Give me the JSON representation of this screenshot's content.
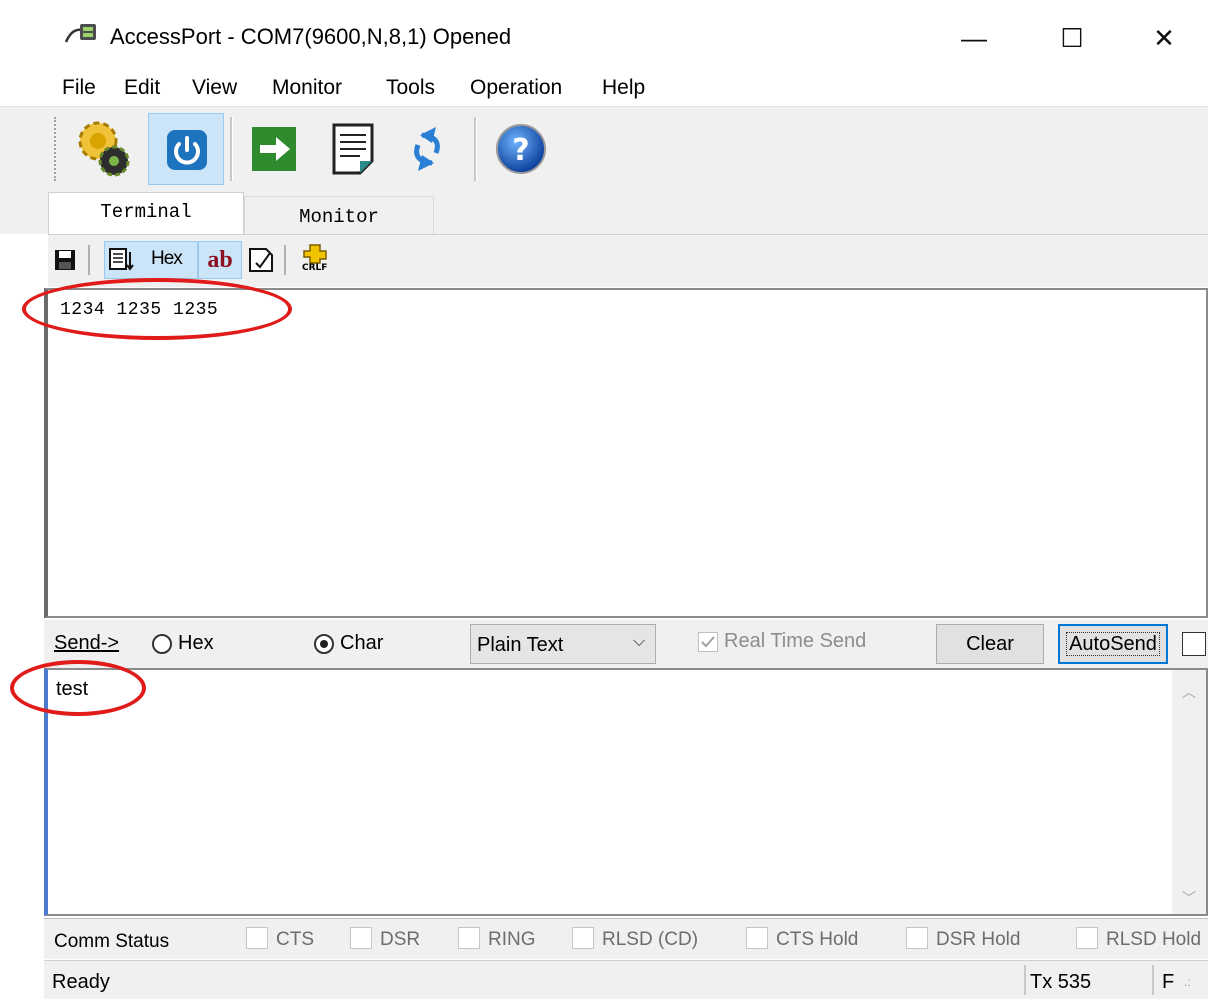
{
  "window": {
    "title": "AccessPort - COM7(9600,N,8,1) Opened",
    "app_icon": "serial-port-icon",
    "minimize": "—",
    "maximize": "☐",
    "close": "✕"
  },
  "menu": [
    "File",
    "Edit",
    "View",
    "Monitor",
    "Tools",
    "Operation",
    "Help"
  ],
  "toolbar": {
    "icons": [
      "config-gears-icon",
      "power-icon",
      "send-arrow-icon",
      "document-icon",
      "refresh-arrows-icon",
      "help-icon"
    ]
  },
  "tabs": [
    {
      "label": "Terminal",
      "active": true
    },
    {
      "label": "Monitor",
      "active": false
    }
  ],
  "terminal_toolbar": {
    "hex_label": "Hex",
    "ab_label": "ab",
    "crlf_label": "CRLF"
  },
  "output": {
    "text": "1234 1235 1235"
  },
  "send": {
    "label": "Send->",
    "mode_hex": "Hex",
    "mode_char": "Char",
    "selected_mode": "Char",
    "format_value": "Plain Text",
    "realtime_label": "Real Time Send",
    "realtime_checked": true,
    "clear_label": "Clear",
    "autosend_label": "AutoSend",
    "input_text": "test"
  },
  "comm_status": {
    "label": "Comm Status",
    "signals": [
      "CTS",
      "DSR",
      "RING",
      "RLSD (CD)",
      "CTS Hold",
      "DSR Hold",
      "RLSD Hold"
    ]
  },
  "status": {
    "left": "Ready",
    "tx": "Tx 535",
    "right": "F"
  },
  "colors": {
    "annotation": "#e11a1a",
    "focus": "#4a7bd0",
    "chrome": "#f0f0f0"
  }
}
